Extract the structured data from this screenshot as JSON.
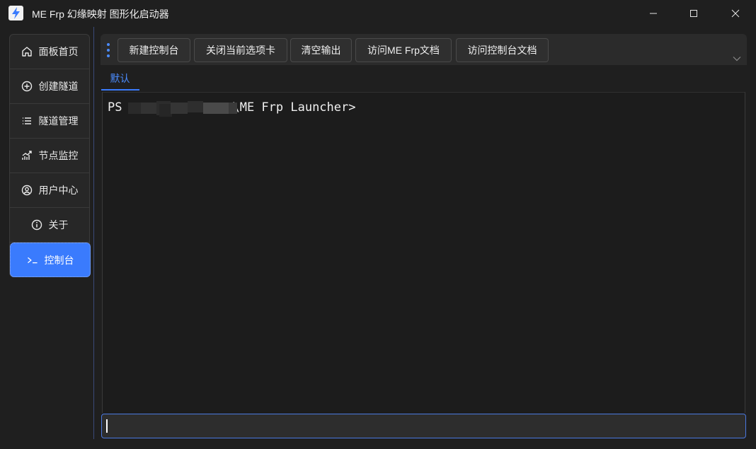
{
  "window": {
    "title": "ME Frp 幻缘映射 图形化启动器",
    "controls": [
      "minimize",
      "maximize",
      "close"
    ]
  },
  "sidebar": {
    "items": [
      {
        "label": "面板首页",
        "icon": "home-icon",
        "active": false
      },
      {
        "label": "创建隧道",
        "icon": "plus-circle-icon",
        "active": false
      },
      {
        "label": "隧道管理",
        "icon": "list-icon",
        "active": false
      },
      {
        "label": "节点监控",
        "icon": "chart-icon",
        "active": false
      },
      {
        "label": "用户中心",
        "icon": "user-circle-icon",
        "active": false
      },
      {
        "label": "关于",
        "icon": "info-icon",
        "active": false
      },
      {
        "label": "控制台",
        "icon": "terminal-icon",
        "active": true
      }
    ]
  },
  "toolbar": {
    "buttons": [
      {
        "label": "新建控制台"
      },
      {
        "label": "关闭当前选项卡"
      },
      {
        "label": "清空输出"
      },
      {
        "label": "访问ME Frp文档"
      },
      {
        "label": "访问控制台文档"
      }
    ]
  },
  "tabs": [
    {
      "label": "默认",
      "active": true
    }
  ],
  "console": {
    "prompt_prefix": "PS",
    "prompt_suffix": "\\ME Frp Launcher>"
  },
  "input": {
    "value": "",
    "placeholder": ""
  },
  "colors": {
    "accent": "#3a7bfd",
    "background": "#1f1f1f",
    "panel": "#2b2b2b",
    "console_bg": "#1c1c1c",
    "tab_text": "#4b8cff"
  }
}
